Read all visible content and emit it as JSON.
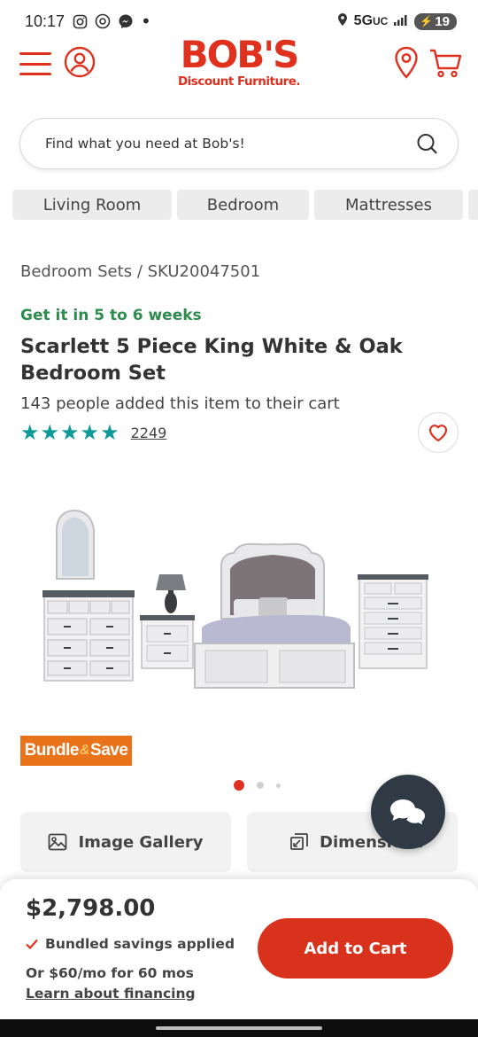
{
  "status_bar": {
    "time": "10:17",
    "network": "5G",
    "network_suffix": "UC",
    "battery": "19"
  },
  "header": {
    "logo_main": "BOB'S",
    "logo_sub": "Discount Furniture.",
    "brand_color": "#e0301e"
  },
  "search": {
    "placeholder": "Find what you need at Bob's!"
  },
  "categories": [
    {
      "label": "Living Room"
    },
    {
      "label": "Bedroom"
    },
    {
      "label": "Mattresses"
    }
  ],
  "product": {
    "breadcrumb_parent": "Bedroom Sets",
    "breadcrumb_sep": "/",
    "sku": "SKU20047501",
    "delivery": "Get it in 5 to 6 weeks",
    "title": "Scarlett 5 Piece King White & Oak Bedroom Set",
    "cart_count_text": "143 people added this item to their cart",
    "rating_stars": 5,
    "review_count": "2249",
    "badge_left": "Bundle",
    "badge_amp": "&",
    "badge_right": "Save",
    "carousel": {
      "total": 3,
      "active": 1
    }
  },
  "actions": {
    "gallery_label": "Image Gallery",
    "dimensions_label": "Dimensions"
  },
  "purchase": {
    "price": "$2,798.00",
    "bundled_text": "Bundled savings applied",
    "finance_text": "Or $60/mo for 60 mos",
    "learn_text": "Learn about financing",
    "add_to_cart": "Add to Cart"
  },
  "colors": {
    "accent": "#e0301e",
    "delivery_green": "#2e8b4e",
    "star_teal": "#0f9a9a",
    "chat_bg": "#2f3a45"
  }
}
